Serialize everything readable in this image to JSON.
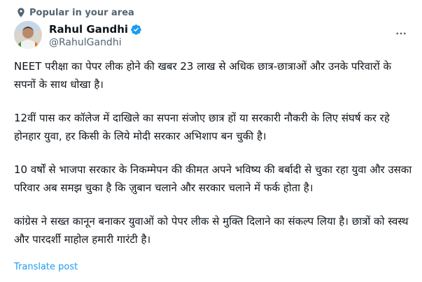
{
  "context": {
    "label": "Popular in your area",
    "icon": "location-pin-icon"
  },
  "author": {
    "display_name": "Rahul Gandhi",
    "handle": "@RahulGandhi",
    "verified": true,
    "verified_color": "#1d9bf0"
  },
  "post": {
    "paragraphs": [
      "NEET परीक्षा का पेपर लीक होने की खबर 23 लाख से अधिक छात्र-छात्राओं और उनके परिवारों के सपनों के साथ धोखा है।",
      "12वीं पास कर कॉलेज में दाखिले का सपना संजोए छात्र हों या सरकारी नौकरी के लिए संघर्ष कर रहे होनहार युवा, हर किसी के लिये मोदी सरकार अभिशाप बन चुकी है।",
      "10 वर्षों से भाजपा सरकार के निकम्मेपन की कीमत अपने भविष्य की बर्बादी से चुका रहा युवा और उसका परिवार अब समझ चुका है कि ज़ुबान चलाने और सरकार चलाने में फर्क होता है।",
      "कांग्रेस ने सख्त कानून बनाकर युवाओं को पेपर लीक से मुक्ति दिलाने का संकल्प लिया है। छात्रों को स्वस्थ और पारदर्शी माहोल हमारी गारंटी है।"
    ],
    "translate_label": "Translate post"
  },
  "colors": {
    "text": "#0f1419",
    "secondary": "#536471",
    "link": "#1d9bf0"
  }
}
